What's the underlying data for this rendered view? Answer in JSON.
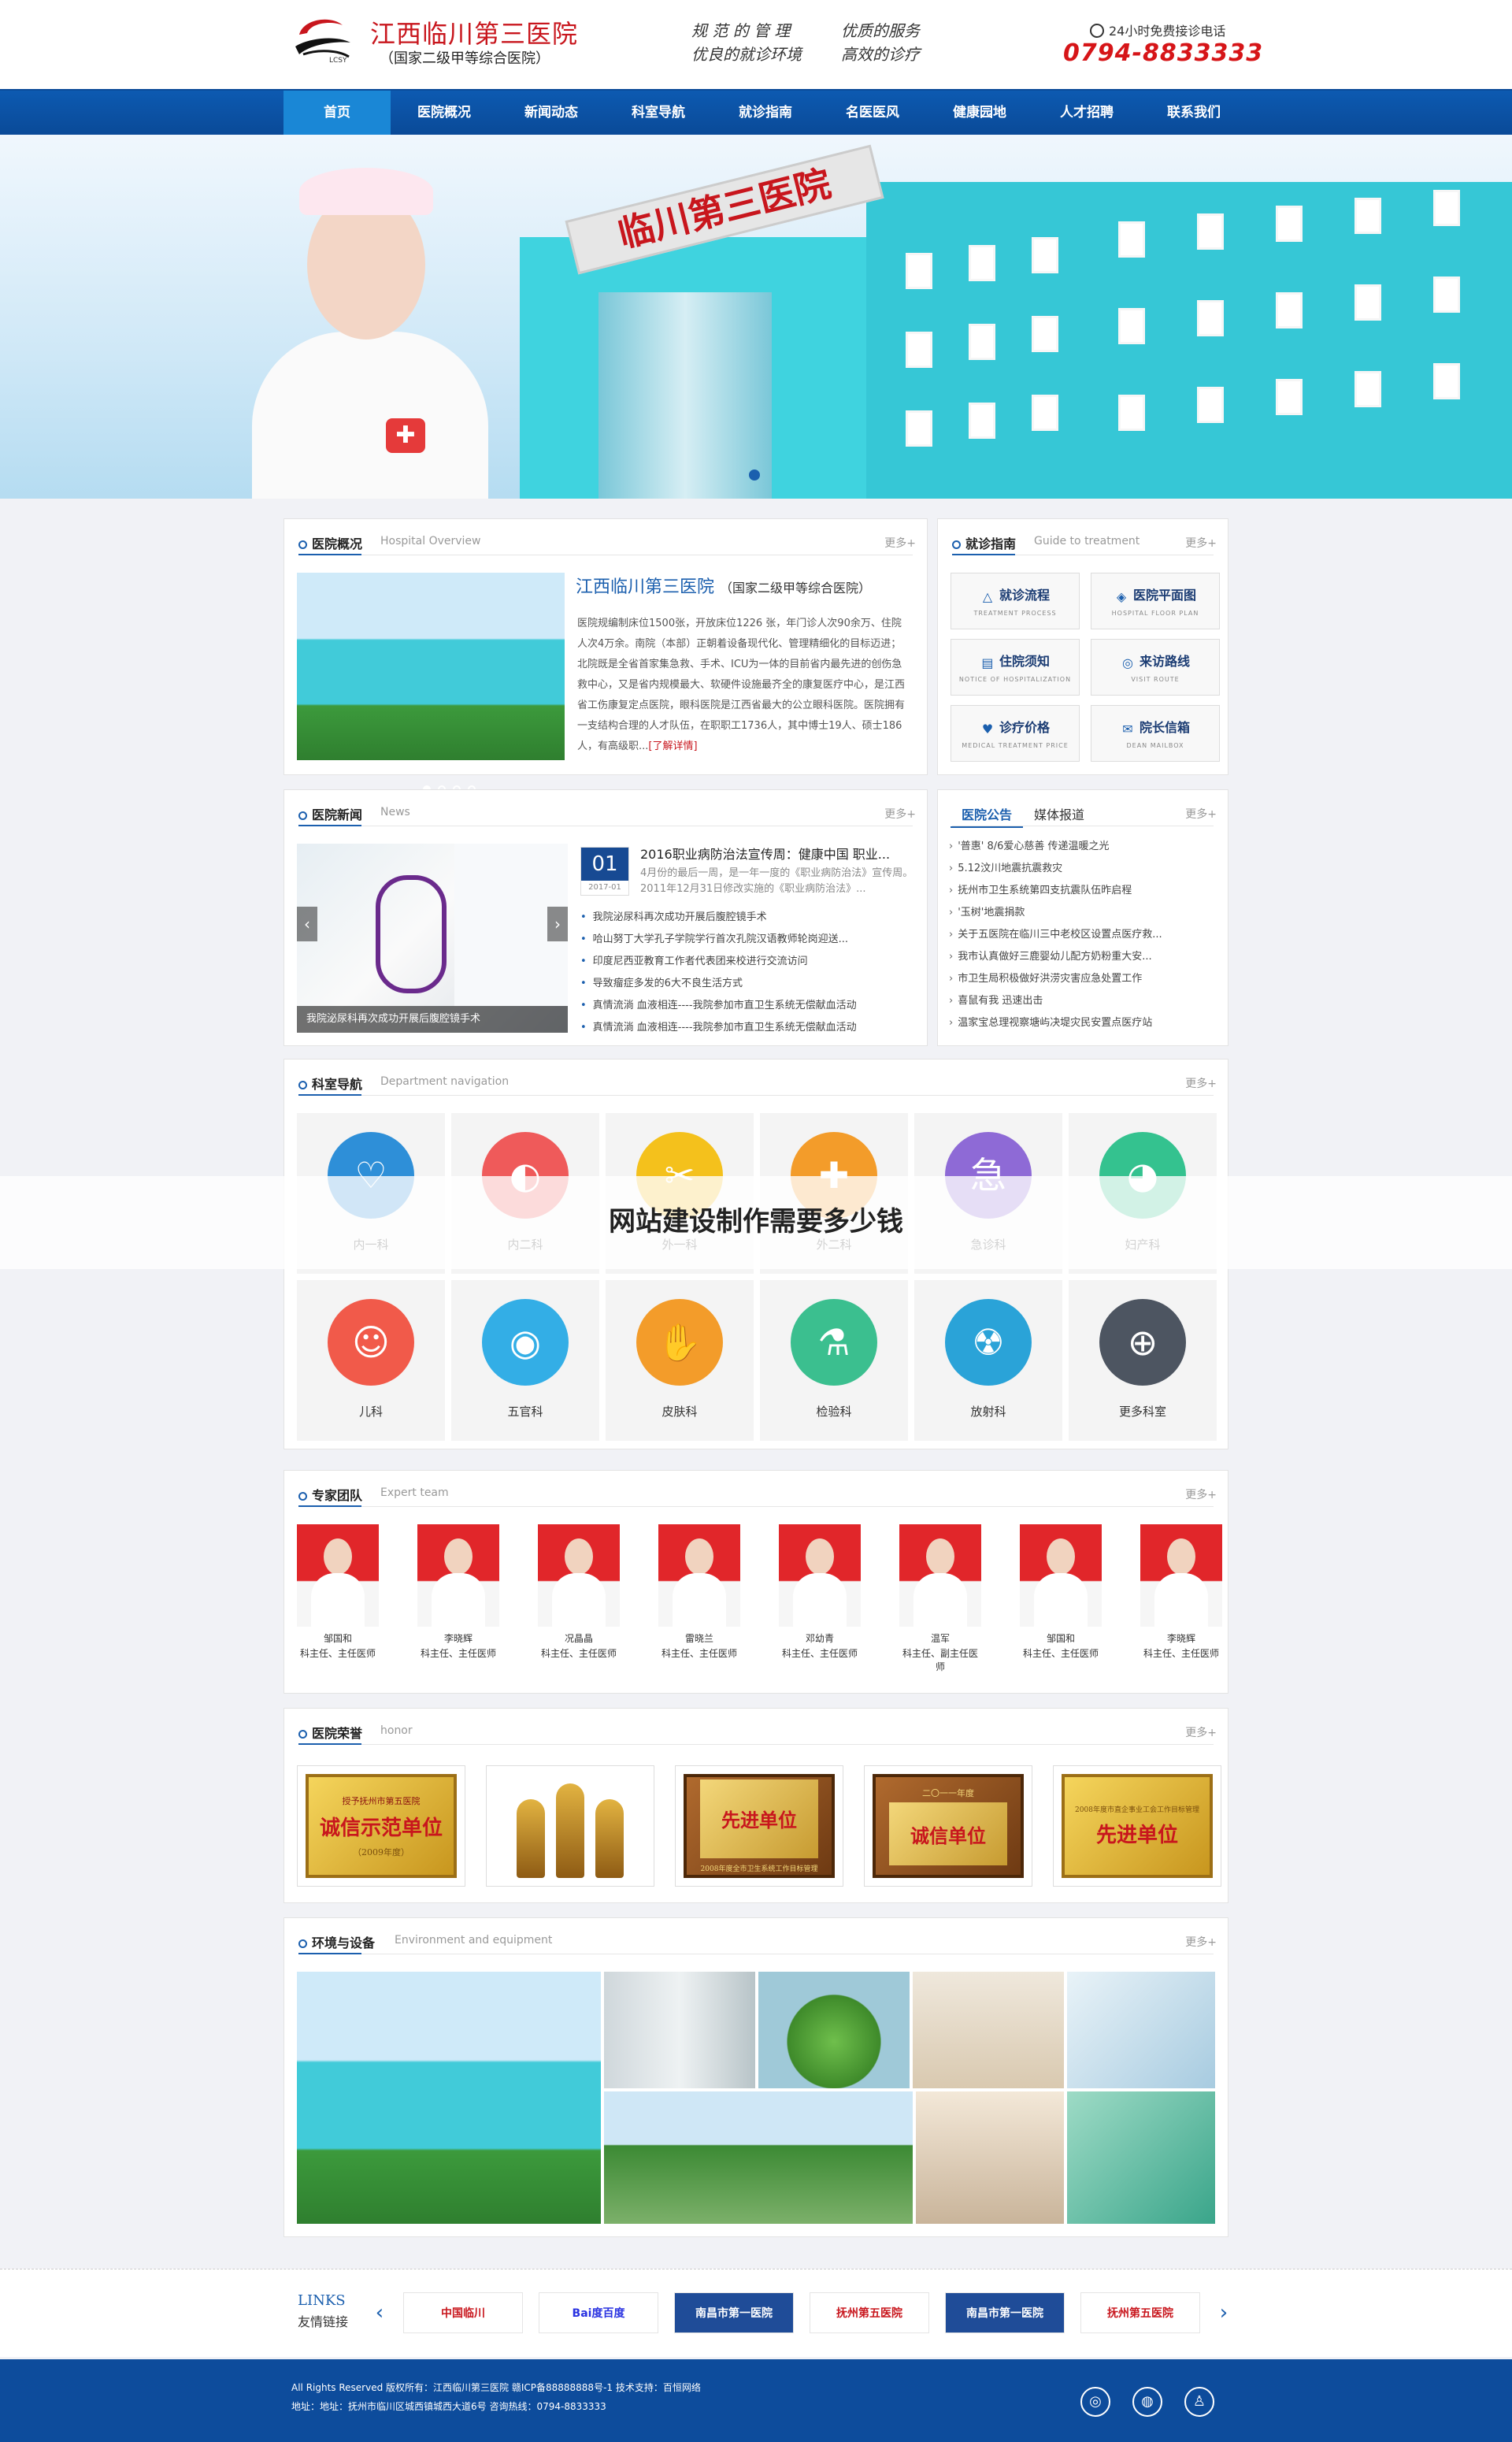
{
  "header": {
    "logo_name": "江西临川第三医院",
    "logo_sub": "（国家二级甲等综合医院）",
    "logo_letters": "LCSY",
    "slogan": [
      "规 范 的 管 理",
      "优质的服务",
      "优良的就诊环境",
      "高效的诊疗"
    ],
    "phone_label": "24小时免费接诊电话",
    "phone": "0794-8833333"
  },
  "nav": [
    "首页",
    "医院概况",
    "新闻动态",
    "科室导航",
    "就诊指南",
    "名医医风",
    "健康园地",
    "人才招聘",
    "联系我们"
  ],
  "banner": {
    "sign": "临川第三医院"
  },
  "overview": {
    "title": "医院概况",
    "title_en": "Hospital Overview",
    "more": "更多+",
    "name": "江西临川第三医院",
    "grade": "（国家二级甲等综合医院）",
    "text": "医院规编制床位1500张，开放床位1226 张，年门诊人次90余万、住院人次4万余。南院（本部）正朝着设备现代化、管理精细化的目标迈进；北院既是全省首家集急救、手术、ICU为一体的目前省内最先进的创伤急救中心，又是省内规模最大、软硬件设施最齐全的康复医疗中心，是江西省工伤康复定点医院，眼科医院是江西省最大的公立眼科医院。医院拥有一支结构合理的人才队伍，在职职工1736人，其中博士19人、硕士186人，有高级职...",
    "read_more": "[了解详情]"
  },
  "guide": {
    "title": "就诊指南",
    "title_en": "Guide to treatment",
    "more": "更多+",
    "items": [
      {
        "label": "就诊流程",
        "en": "TREATMENT PROCESS",
        "icon": "△"
      },
      {
        "label": "医院平面图",
        "en": "HOSPITAL FLOOR PLAN",
        "icon": "◈"
      },
      {
        "label": "住院须知",
        "en": "NOTICE OF HOSPITALIZATION",
        "icon": "▤"
      },
      {
        "label": "来访路线",
        "en": "VISIT ROUTE",
        "icon": "◎"
      },
      {
        "label": "诊疗价格",
        "en": "MEDICAL TREATMENT PRICE",
        "icon": "♥"
      },
      {
        "label": "院长信箱",
        "en": "DEAN MAILBOX",
        "icon": "✉"
      }
    ]
  },
  "news": {
    "title": "医院新闻",
    "title_en": "News",
    "more": "更多+",
    "image_caption": "我院泌尿科再次成功开展后腹腔镜手术",
    "date_day": "01",
    "date_ym": "2017-01",
    "headline": "2016职业病防治法宣传周：健康中国 职业...",
    "summary": "4月份的最后一周，是一年一度的《职业病防治法》宣传周。2011年12月31日修改实施的《职业病防治法》...",
    "list": [
      "我院泌尿科再次成功开展后腹腔镜手术",
      "哈山努丁大学孔子学院学行首次孔院汉语教师轮岗迎送...",
      "印度尼西亚教育工作者代表团来校进行交流访问",
      "导致瘤症多发的6大不良生活方式",
      "真情流淌 血液相连----我院参加市直卫生系统无偿献血活动",
      "真情流淌 血液相连----我院参加市直卫生系统无偿献血活动"
    ]
  },
  "notice": {
    "tab_active": "医院公告",
    "tab_other": "媒体报道",
    "more": "更多+",
    "list": [
      "'普惠' 8/6爱心慈善 传递温暖之光",
      "5.12汶川地震抗震救灾",
      "抚州市卫生系统第四支抗震队伍昨启程",
      "'玉树'地震捐款",
      "关于五医院在临川三中老校区设置点医疗救...",
      "我市认真做好三鹿婴幼儿配方奶粉重大安...",
      "市卫生局积极做好洪涝灾害应急处置工作",
      "喜鼠有我 迅速出击",
      "温家宝总理视察塘屿决堤灾民安置点医疗站"
    ]
  },
  "departments": {
    "title": "科室导航",
    "title_en": "Department navigation",
    "more": "更多+",
    "items": [
      {
        "label": "内一科",
        "icon": "heart-icon",
        "color": "#2e8fd8",
        "glyph": "♡"
      },
      {
        "label": "内二科",
        "icon": "stomach-icon",
        "color": "#ef5a5a",
        "glyph": "◐"
      },
      {
        "label": "外一科",
        "icon": "scissors-icon",
        "color": "#f4c11c",
        "glyph": "✂"
      },
      {
        "label": "外二科",
        "icon": "medkit-icon",
        "color": "#f39c2a",
        "glyph": "✚"
      },
      {
        "label": "急诊科",
        "icon": "emergency-icon",
        "color": "#8e6ad6",
        "glyph": "急"
      },
      {
        "label": "妇产科",
        "icon": "pregnancy-icon",
        "color": "#34c28f",
        "glyph": "◕"
      },
      {
        "label": "儿科",
        "icon": "baby-face-icon",
        "color": "#f15a4a",
        "glyph": "☺"
      },
      {
        "label": "五官科",
        "icon": "eye-icon",
        "color": "#33aee6",
        "glyph": "◉"
      },
      {
        "label": "皮肤科",
        "icon": "hand-icon",
        "color": "#f39c2a",
        "glyph": "✋"
      },
      {
        "label": "检验科",
        "icon": "flask-icon",
        "color": "#3bbf8f",
        "glyph": "⚗"
      },
      {
        "label": "放射科",
        "icon": "radiation-icon",
        "color": "#2aa3d8",
        "glyph": "☢"
      },
      {
        "label": "更多科室",
        "icon": "plus-circle-icon",
        "color": "#4d5561",
        "glyph": "⊕"
      }
    ]
  },
  "overlay_title": "网站建设制作需要多少钱",
  "experts": {
    "title": "专家团队",
    "title_en": "Expert team",
    "more": "更多+",
    "items": [
      {
        "name": "邹国和",
        "role": "科主任、主任医师"
      },
      {
        "name": "李晓辉",
        "role": "科主任、主任医师"
      },
      {
        "name": "况晶晶",
        "role": "科主任、主任医师"
      },
      {
        "name": "雷晓兰",
        "role": "科主任、主任医师"
      },
      {
        "name": "邓幼青",
        "role": "科主任、主任医师"
      },
      {
        "name": "温军",
        "role": "科主任、副主任医师"
      },
      {
        "name": "邹国和",
        "role": "科主任、主任医师"
      },
      {
        "name": "李晓辉",
        "role": "科主任、主任医师"
      }
    ]
  },
  "honors": {
    "title": "医院荣誉",
    "title_en": "honor",
    "more": "更多+",
    "items": [
      {
        "main": "诚信示范单位",
        "sub": "（2009年度）",
        "top": "授予抚州市第五医院"
      },
      {
        "main": "",
        "sub": ""
      },
      {
        "main": "先进单位",
        "sub": "2008年度全市卫生系统工作目标管理"
      },
      {
        "main": "诚信单位",
        "sub": "二〇一一年度"
      },
      {
        "main": "先进单位",
        "sub": "2008年度市直企事业工会工作目标管理"
      }
    ]
  },
  "environment": {
    "title": "环境与设备",
    "title_en": "Environment and equipment",
    "more": "更多+"
  },
  "links": {
    "en": "LINKS",
    "cn": "友情链接",
    "items": [
      "中国临川",
      "Bai度百度",
      "南昌市第一医院",
      "抚州第五医院",
      "南昌市第一医院",
      "抚州第五医院"
    ]
  },
  "footer": {
    "line1": "All Rights Reserved 版权所有：江西临川第三医院 赣ICP备88888888号-1  技术支持：百恒网络",
    "line2": "地址：地址：抚州市临川区城西镇城西大道6号  咨询热线：0794-8833333"
  }
}
